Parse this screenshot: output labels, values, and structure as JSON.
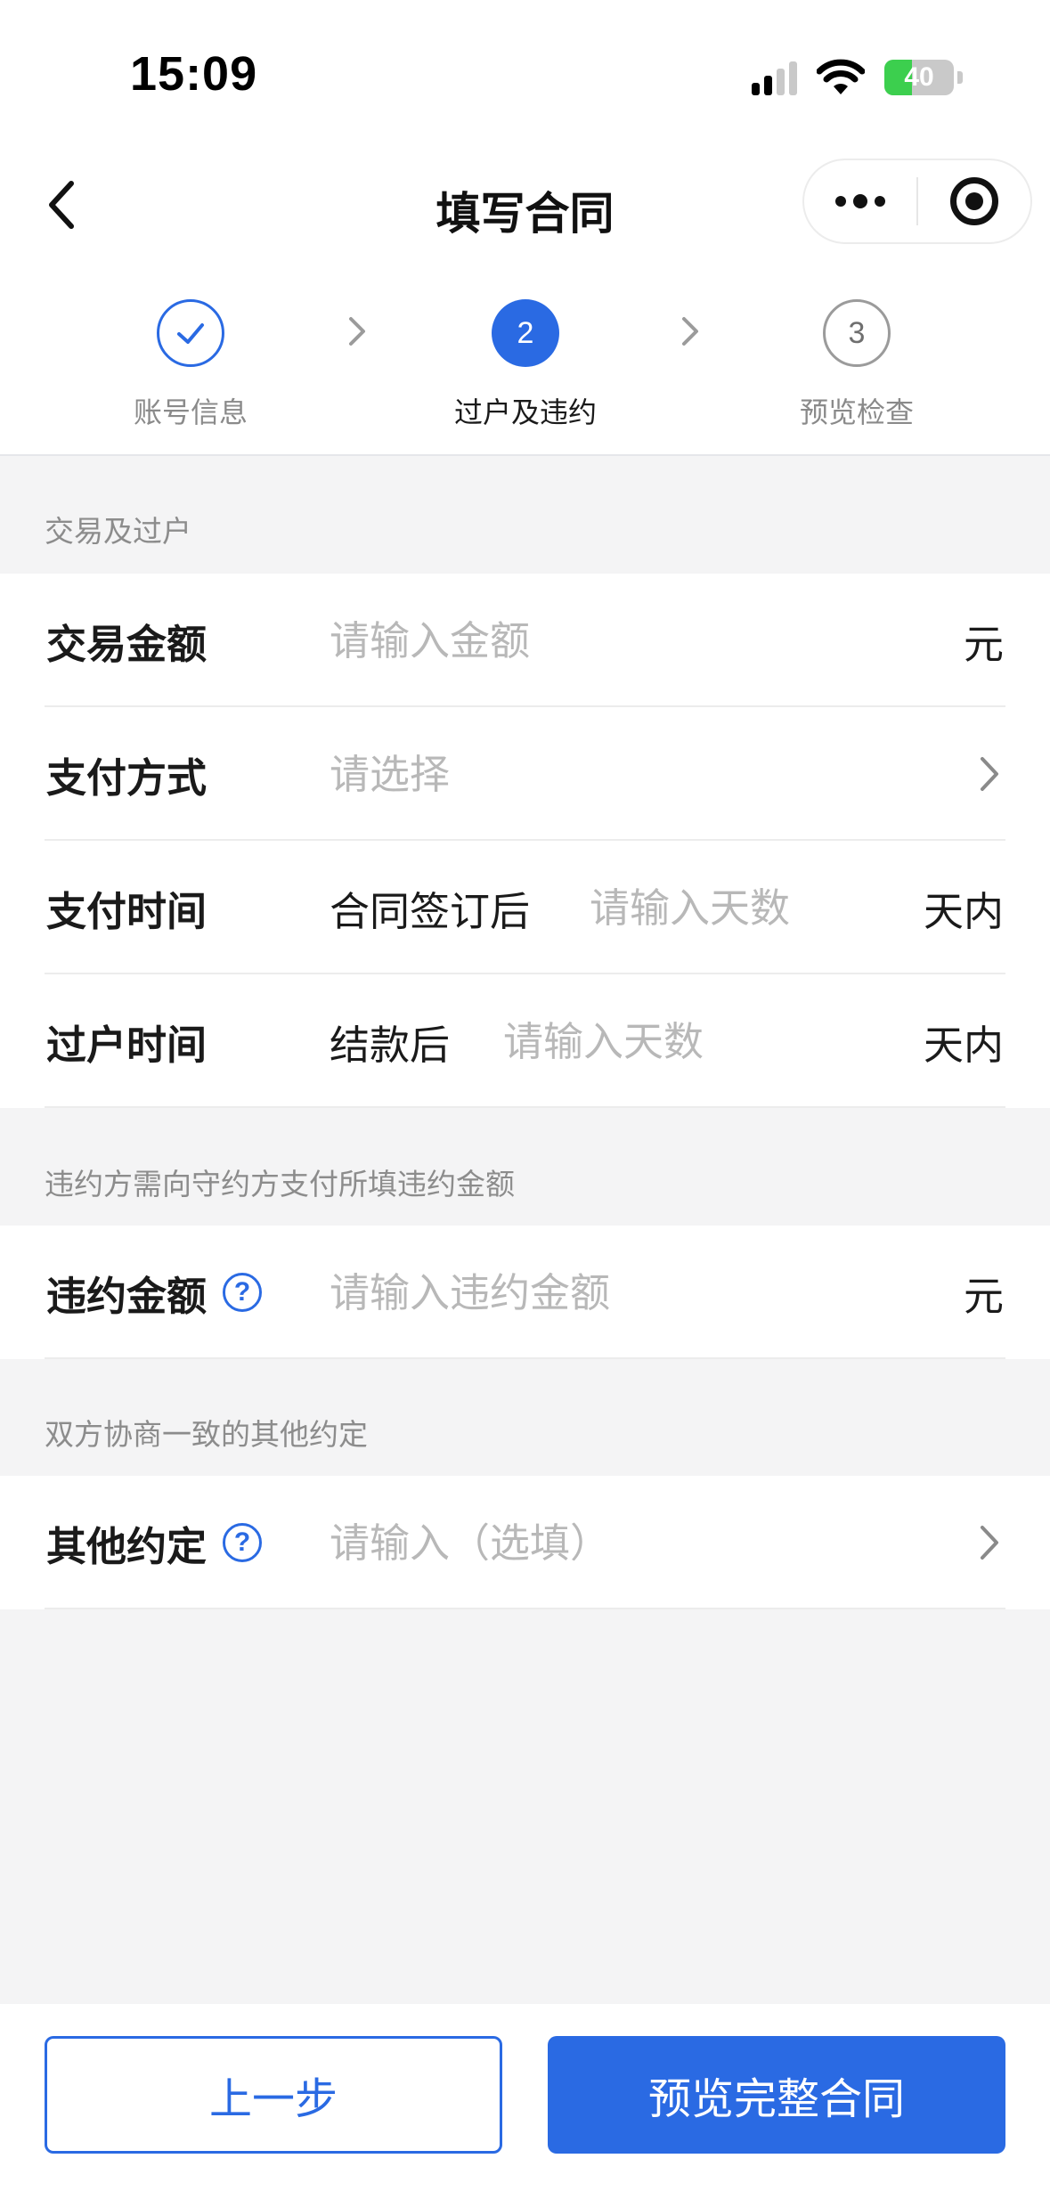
{
  "status_bar": {
    "time": "15:09",
    "battery_level": "40",
    "battery_percent": 40,
    "icons": [
      "signal-icon",
      "wifi-icon",
      "battery-icon"
    ]
  },
  "nav": {
    "title": "填写合同",
    "icons": [
      "back-chevron-icon",
      "more-dots-icon",
      "record-target-icon"
    ]
  },
  "stepper": {
    "steps": [
      {
        "label": "账号信息",
        "state": "done"
      },
      {
        "label": "过户及违约",
        "number": "2",
        "state": "active"
      },
      {
        "label": "预览检查",
        "number": "3",
        "state": "todo"
      }
    ]
  },
  "section_trade": {
    "title": "交易及过户",
    "amount": {
      "label": "交易金额",
      "placeholder": "请输入金额",
      "unit": "元"
    },
    "pay_method": {
      "label": "支付方式",
      "placeholder": "请选择"
    },
    "pay_time": {
      "label": "支付时间",
      "prefix": "合同签订后",
      "placeholder": "请输入天数",
      "unit": "天内"
    },
    "transfer_time": {
      "label": "过户时间",
      "prefix": "结款后",
      "placeholder": "请输入天数",
      "unit": "天内"
    }
  },
  "section_breach": {
    "title": "违约方需向守约方支付所填违约金额",
    "amount": {
      "label": "违约金额",
      "placeholder": "请输入违约金额",
      "unit": "元"
    }
  },
  "section_other": {
    "title": "双方协商一致的其他约定",
    "other": {
      "label": "其他约定",
      "placeholder": "请输入（选填）"
    }
  },
  "help_glyph": "?",
  "buttons": {
    "prev": "上一步",
    "preview": "预览完整合同"
  },
  "colors": {
    "accent": "#2a6ae3",
    "background": "#f4f4f5",
    "placeholder": "#b8b8b8",
    "section_title": "#8c8c8c",
    "battery_green": "#3ccf4e"
  }
}
